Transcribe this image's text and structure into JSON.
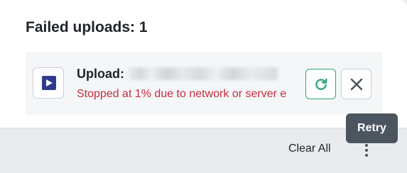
{
  "panel": {
    "title": "Failed uploads: 1"
  },
  "upload": {
    "file_icon": "video-play-icon",
    "name_prefix": "Upload:",
    "status": "Stopped at 1% due to network or server e",
    "retry_icon": "refresh-icon",
    "remove_icon": "close-icon"
  },
  "footer": {
    "clear_all_label": "Clear All",
    "more_icon": "more-vertical-icon"
  },
  "tooltip": {
    "text": "Retry"
  },
  "colors": {
    "error_text": "#c62d3d",
    "retry_accent": "#2ea57d",
    "tooltip_bg": "#4b5560",
    "file_icon": "#2f3b8f"
  }
}
